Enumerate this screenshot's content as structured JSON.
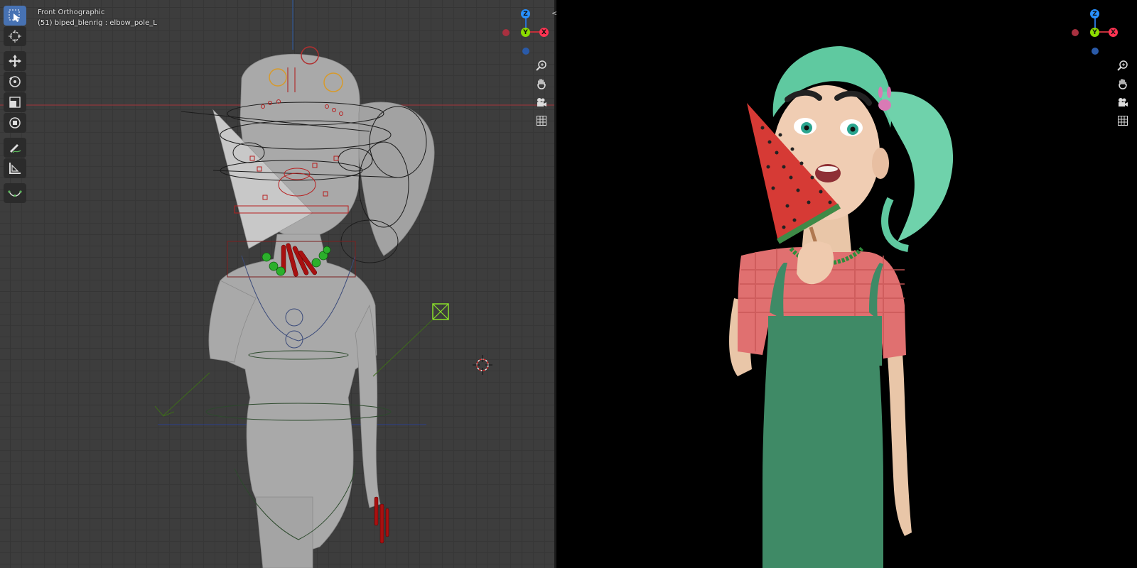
{
  "viewport_left": {
    "view_name": "Front Orthographic",
    "selection_info": "(51) biped_blenrig : elbow_pole_L"
  },
  "toolbar": {
    "tools": [
      {
        "name": "select-box-tool",
        "icon": "select-box-icon",
        "active": true
      },
      {
        "name": "cursor-tool",
        "icon": "cursor-icon",
        "active": false
      },
      {
        "name": "move-tool",
        "icon": "move-icon",
        "active": false
      },
      {
        "name": "rotate-tool",
        "icon": "rotate-icon",
        "active": false
      },
      {
        "name": "scale-tool",
        "icon": "scale-icon",
        "active": false
      },
      {
        "name": "transform-tool",
        "icon": "transform-icon",
        "active": false
      },
      {
        "name": "annotate-tool",
        "icon": "annotate-icon",
        "active": false
      },
      {
        "name": "measure-tool",
        "icon": "measure-icon",
        "active": false
      },
      {
        "name": "bone-envelope-tool",
        "icon": "bone-envelope-icon",
        "active": false
      }
    ]
  },
  "gizmo": {
    "z_label": "Z",
    "y_label": "Y",
    "x_label": "X",
    "colors": {
      "x": "#ff3352",
      "y": "#8bdc00",
      "z": "#2890ff"
    }
  },
  "nav_buttons": [
    "zoom-icon",
    "pan-hand-icon",
    "camera-icon",
    "grid-icon"
  ],
  "colors": {
    "active_tool": "#4772b3",
    "viewport_bg": "#3d3d3d",
    "render_bg": "#000000"
  }
}
